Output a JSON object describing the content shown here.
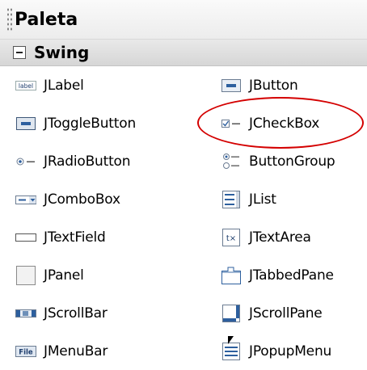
{
  "palette": {
    "title": "Paleta"
  },
  "category": {
    "label": "Swing",
    "expanded": true
  },
  "items": [
    {
      "label": "JLabel",
      "icon": "jlabel-icon"
    },
    {
      "label": "JButton",
      "icon": "jbutton-icon"
    },
    {
      "label": "JToggleButton",
      "icon": "jtogglebutton-icon"
    },
    {
      "label": "JCheckBox",
      "icon": "jcheckbox-icon"
    },
    {
      "label": "JRadioButton",
      "icon": "jradiobutton-icon"
    },
    {
      "label": "ButtonGroup",
      "icon": "buttongroup-icon"
    },
    {
      "label": "JComboBox",
      "icon": "jcombobox-icon"
    },
    {
      "label": "JList",
      "icon": "jlist-icon"
    },
    {
      "label": "JTextField",
      "icon": "jtextfield-icon"
    },
    {
      "label": "JTextArea",
      "icon": "jtextarea-icon"
    },
    {
      "label": "JPanel",
      "icon": "jpanel-icon"
    },
    {
      "label": "JTabbedPane",
      "icon": "jtabbedpane-icon"
    },
    {
      "label": "JScrollBar",
      "icon": "jscrollbar-icon"
    },
    {
      "label": "JScrollPane",
      "icon": "jscrollpane-icon"
    },
    {
      "label": "JMenuBar",
      "icon": "jmenubar-icon"
    },
    {
      "label": "JPopupMenu",
      "icon": "jpopupmenu-icon"
    }
  ],
  "icon_text": {
    "jlabel": "label",
    "jmenubar": "File",
    "jtextarea": "t×"
  },
  "colors": {
    "annotation": "#d40000",
    "icon_blue": "#2d5f9e"
  }
}
